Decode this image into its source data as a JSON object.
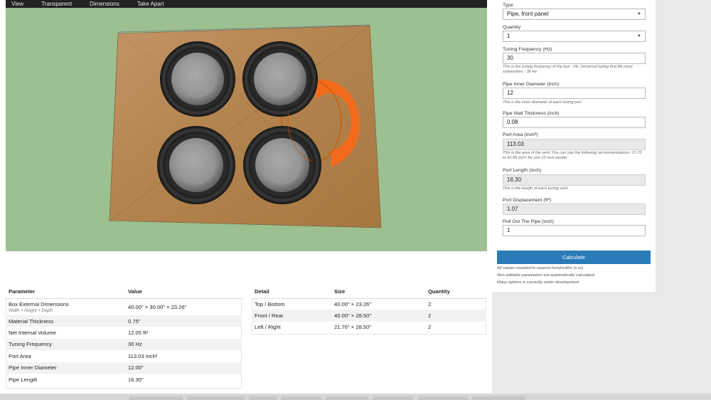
{
  "menu": [
    "View",
    "Transparent",
    "Dimensions",
    "Take Apart"
  ],
  "params_table": {
    "headers": [
      "Parameter",
      "Value"
    ],
    "rows": [
      {
        "name": "Box External Dimensions",
        "sub": "Width × Height × Depth",
        "value": "40.00\" × 30.00\" × 23.26\""
      },
      {
        "name": "Material Thickness",
        "value": "0.75\""
      },
      {
        "name": "Net Internal Volume",
        "value": "12.05 ft³"
      },
      {
        "name": "Tuning Frequency",
        "value": "30 Hz"
      },
      {
        "name": "Port Area",
        "value": "113.03 inch²"
      },
      {
        "name": "Pipe Inner Diameter",
        "value": "12.00\""
      },
      {
        "name": "Pipe Length",
        "value": "16.30\""
      }
    ]
  },
  "detail_table": {
    "headers": [
      "Detail",
      "Size",
      "Quantity"
    ],
    "rows": [
      {
        "detail": "Top / Bottom",
        "size": "40.00\" × 23.26\"",
        "qty": "2"
      },
      {
        "detail": "Front / Rear",
        "size": "40.00\" × 28.50\"",
        "qty": "2"
      },
      {
        "detail": "Left / Right",
        "size": "21.76\" × 28.50\"",
        "qty": "2"
      }
    ]
  },
  "form": {
    "type_label": "Type",
    "type_value": "Pipe, front panel",
    "quantity_label": "Quantity",
    "quantity_value": "1",
    "tuning_label": "Tuning Frequency (Hz)",
    "tuning_value": "30",
    "tuning_help": "This is the tuning frequency of the box - Fb. Universal tuning that fits most subwoofers - 36 Hz",
    "diameter_label": "Pipe Inner Diameter (inch)",
    "diameter_value": "12",
    "diameter_help": "This is the inner diameter of each tuning port",
    "wall_label": "Pipe Wall Thickness (inch)",
    "wall_value": "0.08",
    "port_area_label": "Port Area (inch²)",
    "port_area_value": "113.03",
    "port_area_help": "This is the area of the vent. You can use the following recommendations: 21.70 to 41.85 inch² for one 12 inch woofer",
    "port_length_label": "Port Length (inch)",
    "port_length_value": "16.30",
    "port_length_help": "This is the length of each tuning vent",
    "displacement_label": "Port Displacement (ft³)",
    "displacement_value": "1.07",
    "pull_label": "Pull Out The Pipe (inch)",
    "pull_value": "1",
    "calculate_label": "Calculate",
    "notes": [
      "All values rounded to nearest hundredths (x.xx)",
      "Non-editable parameters are automatically calculated",
      "Many options is currently under development"
    ]
  },
  "colors": {
    "viewport_bg": "#9cc090",
    "wood": "#b98a55",
    "port": "#f26b1d",
    "button": "#2b7bb9"
  }
}
